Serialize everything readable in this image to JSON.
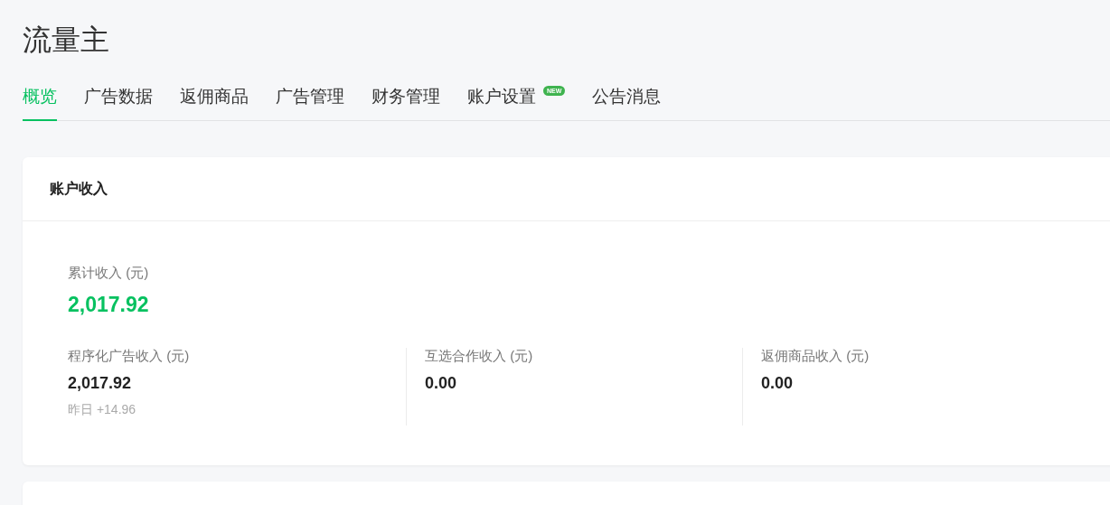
{
  "page": {
    "title": "流量主"
  },
  "tabs": [
    {
      "label": "概览",
      "selected": true
    },
    {
      "label": "广告数据",
      "selected": false
    },
    {
      "label": "返佣商品",
      "selected": false
    },
    {
      "label": "广告管理",
      "selected": false
    },
    {
      "label": "财务管理",
      "selected": false
    },
    {
      "label": "账户设置",
      "selected": false,
      "badge": "NEW"
    },
    {
      "label": "公告消息",
      "selected": false
    }
  ],
  "income_card": {
    "title": "账户收入",
    "total": {
      "label": "累计收入 (元)",
      "value": "2,017.92"
    },
    "stats": [
      {
        "label": "程序化广告收入 (元)",
        "value": "2,017.92",
        "note": "昨日 +14.96"
      },
      {
        "label": "互选合作收入 (元)",
        "value": "0.00"
      },
      {
        "label": "返佣商品收入 (元)",
        "value": "0.00"
      }
    ]
  }
}
